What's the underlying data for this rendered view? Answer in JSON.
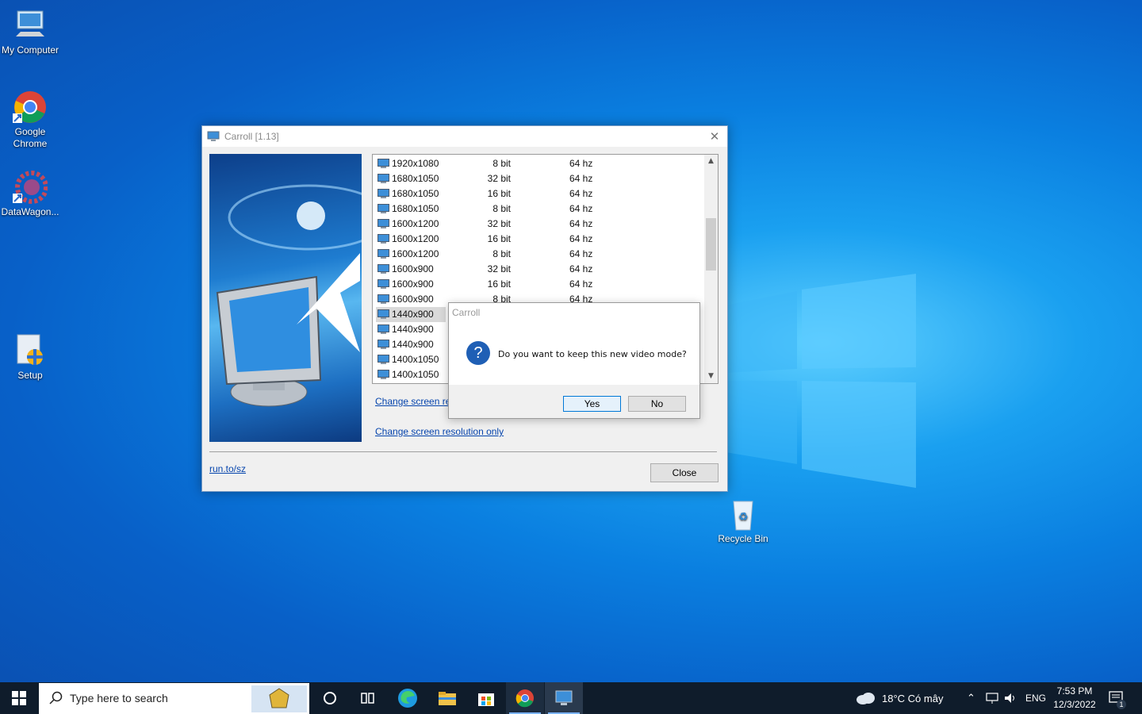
{
  "desktop": {
    "icons": [
      {
        "label": "My Computer"
      },
      {
        "label": "Google Chrome"
      },
      {
        "label": "DataWagon..."
      },
      {
        "label": "Setup"
      },
      {
        "label": "Recycle Bin"
      }
    ]
  },
  "window": {
    "title": "Carroll [1.13]",
    "modes": [
      {
        "res": "1920x1080",
        "bit": "8 bit",
        "hz": "64 hz"
      },
      {
        "res": "1680x1050",
        "bit": "32 bit",
        "hz": "64 hz"
      },
      {
        "res": "1680x1050",
        "bit": "16 bit",
        "hz": "64 hz"
      },
      {
        "res": "1680x1050",
        "bit": "8 bit",
        "hz": "64 hz"
      },
      {
        "res": "1600x1200",
        "bit": "32 bit",
        "hz": "64 hz"
      },
      {
        "res": "1600x1200",
        "bit": "16 bit",
        "hz": "64 hz"
      },
      {
        "res": "1600x1200",
        "bit": "8 bit",
        "hz": "64 hz"
      },
      {
        "res": "1600x900",
        "bit": "32 bit",
        "hz": "64 hz"
      },
      {
        "res": "1600x900",
        "bit": "16 bit",
        "hz": "64 hz"
      },
      {
        "res": "1600x900",
        "bit": "8 bit",
        "hz": "64 hz"
      },
      {
        "res": "1440x900",
        "bit": "",
        "hz": ""
      },
      {
        "res": "1440x900",
        "bit": "",
        "hz": ""
      },
      {
        "res": "1440x900",
        "bit": "",
        "hz": ""
      },
      {
        "res": "1400x1050",
        "bit": "",
        "hz": ""
      },
      {
        "res": "1400x1050",
        "bit": "",
        "hz": ""
      }
    ],
    "selected_index": 10,
    "link_change_partial": "Change screen re",
    "link_change_only": "Change screen resolution only",
    "footer_link": "run.to/sz",
    "close_label": "Close"
  },
  "dialog": {
    "title": "Carroll",
    "question": "Do you want to keep this new video mode?",
    "yes_label": "Yes",
    "no_label": "No"
  },
  "taskbar": {
    "search_placeholder": "Type here to search",
    "weather": "18°C  Có mây",
    "language": "ENG",
    "time": "7:53 PM",
    "date": "12/3/2022",
    "notification_count": "1"
  }
}
